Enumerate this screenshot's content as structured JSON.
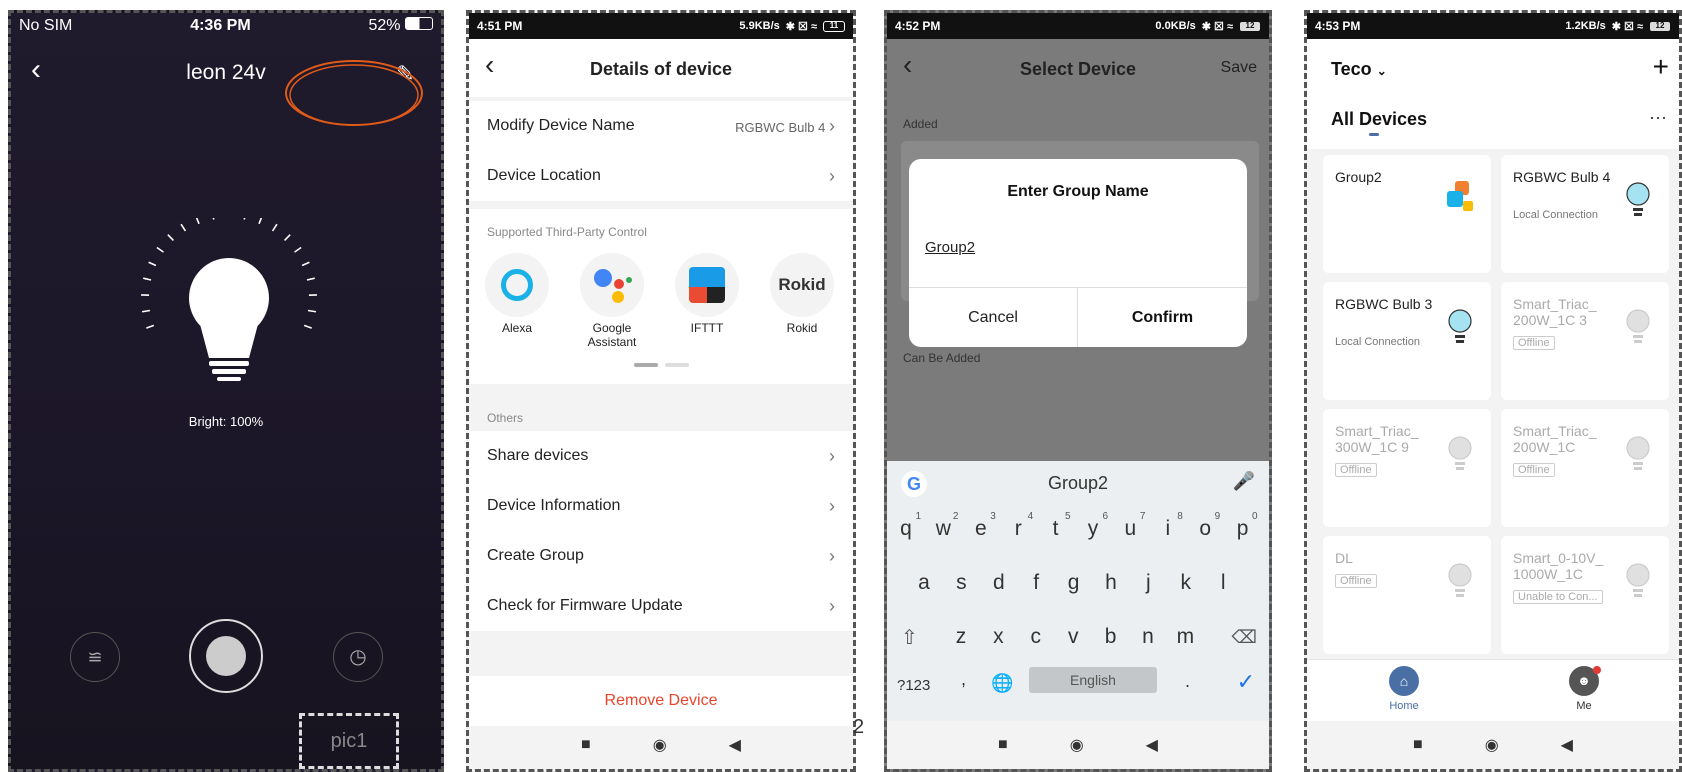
{
  "panel1": {
    "status": {
      "carrier": "No SIM",
      "time": "4:36 PM",
      "battery": "52%"
    },
    "title": "leon 24v",
    "brightness": "Bright: 100%",
    "watermark": "pic1",
    "highlight_color": "#e05a1a"
  },
  "panel2": {
    "status": {
      "time": "4:51 PM",
      "speed": "5.9KB/s",
      "battery": "11"
    },
    "title": "Details of device",
    "rows": [
      {
        "label": "Modify Device Name",
        "value": "RGBWC Bulb 4"
      },
      {
        "label": "Device Location",
        "value": ""
      }
    ],
    "third_party_title": "Supported Third-Party Control",
    "third_party": [
      {
        "name": "Alexa",
        "icon": "alexa-icon"
      },
      {
        "name": "Google Assistant",
        "icon": "google-assistant-icon"
      },
      {
        "name": "IFTTT",
        "icon": "ifttt-icon"
      },
      {
        "name": "Rokid",
        "icon": "rokid-icon"
      }
    ],
    "others_title": "Others",
    "others": [
      "Share devices",
      "Device Information",
      "Create Group",
      "Check for Firmware Update"
    ],
    "remove_label": "Remove Device",
    "remove_color": "#e8452c"
  },
  "divider_label": "2",
  "panel3": {
    "status": {
      "time": "4:52 PM",
      "speed": "0.0KB/s",
      "battery": "12"
    },
    "title": "Select Device",
    "save_label": "Save",
    "added_label": "Added",
    "can_be_added_label": "Can Be Added",
    "dialog": {
      "title": "Enter Group Name",
      "value": "Group2",
      "cancel": "Cancel",
      "confirm": "Confirm"
    },
    "keyboard": {
      "suggestion": "Group2",
      "row1": [
        "q",
        "w",
        "e",
        "r",
        "t",
        "y",
        "u",
        "i",
        "o",
        "p"
      ],
      "row1_hints": [
        "1",
        "2",
        "3",
        "4",
        "5",
        "6",
        "7",
        "8",
        "9",
        "0"
      ],
      "row2": [
        "a",
        "s",
        "d",
        "f",
        "g",
        "h",
        "j",
        "k",
        "l"
      ],
      "row3": [
        "z",
        "x",
        "c",
        "v",
        "b",
        "n",
        "m"
      ],
      "numbers_key": "?123",
      "comma_key": ",",
      "space_label": "English",
      "period_key": "."
    }
  },
  "panel4": {
    "status": {
      "time": "4:53 PM",
      "speed": "1.2KB/s",
      "battery": "12"
    },
    "home_name": "Teco",
    "section_title": "All Devices",
    "devices": [
      {
        "name": "Group2",
        "sub": "",
        "offline": ""
      },
      {
        "name": "RGBWC Bulb 4",
        "sub": "Local Connection",
        "offline": ""
      },
      {
        "name": "RGBWC Bulb 3",
        "sub": "Local Connection",
        "offline": ""
      },
      {
        "name": "Smart_Triac_ 200W_1C 3",
        "sub": "",
        "offline": "Offline"
      },
      {
        "name": "Smart_Triac_ 300W_1C 9",
        "sub": "",
        "offline": "Offline"
      },
      {
        "name": "Smart_Triac_ 200W_1C",
        "sub": "",
        "offline": "Offline"
      },
      {
        "name": "DL",
        "sub": "",
        "offline": "Offline"
      },
      {
        "name": "Smart_0-10V_ 1000W_1C",
        "sub": "",
        "offline": "Unable to Con..."
      }
    ],
    "tabs": [
      "Home",
      "Me"
    ],
    "accent": "#4a6fa5"
  }
}
